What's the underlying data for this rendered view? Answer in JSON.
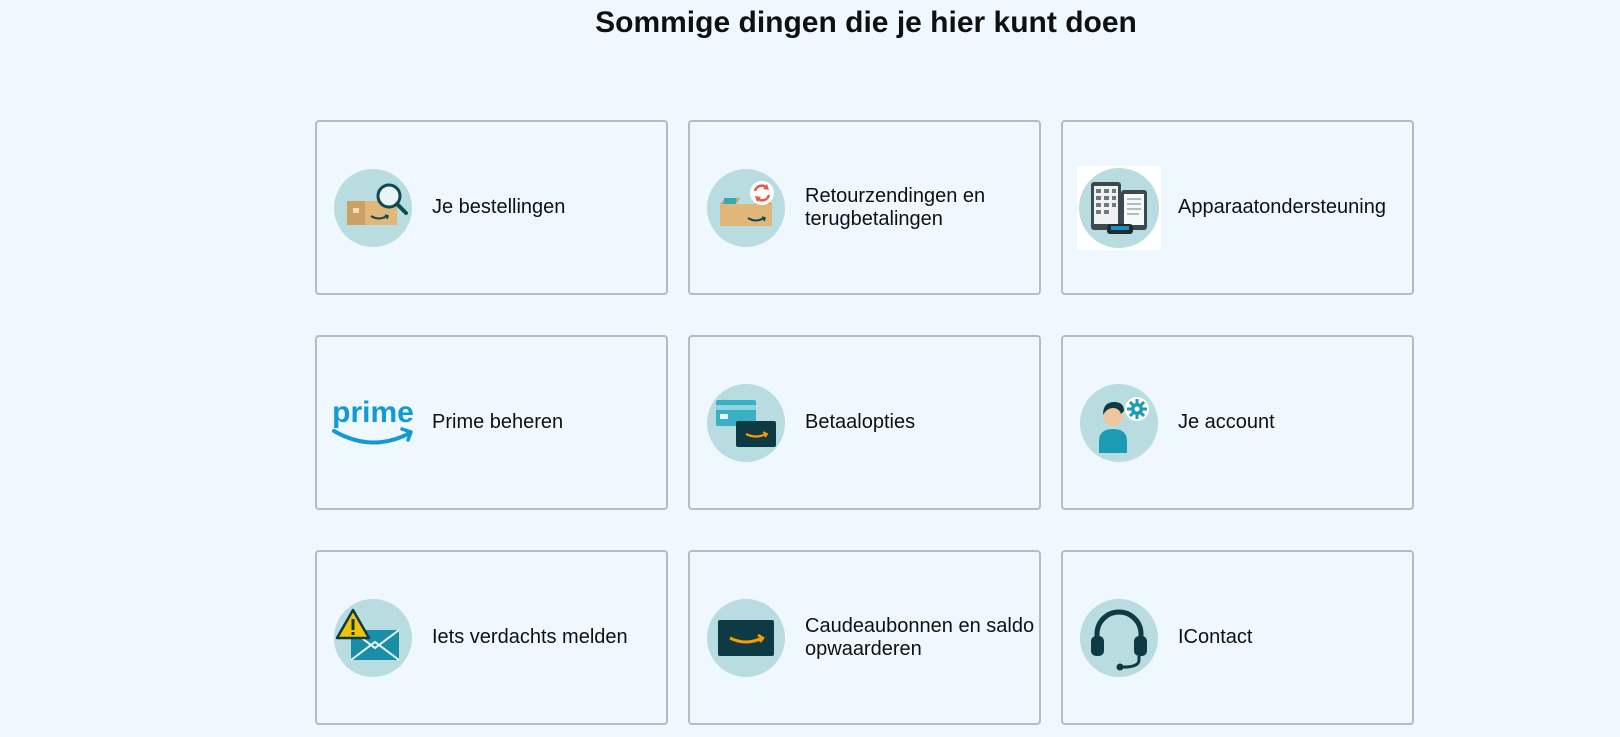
{
  "page": {
    "title": "Sommige dingen die je hier kunt doen"
  },
  "cards": [
    {
      "label": "Je bestellingen",
      "icon": "orders-box-search-icon"
    },
    {
      "label": "Retourzendingen en terugbetalingen",
      "icon": "returns-box-arrows-icon"
    },
    {
      "label": "Apparaatondersteuning",
      "icon": "devices-icon"
    },
    {
      "label": "Prime beheren",
      "icon": "prime-logo-icon",
      "icon_text": "prime"
    },
    {
      "label": "Betaalopties",
      "icon": "payment-cards-icon"
    },
    {
      "label": "Je account",
      "icon": "account-person-gear-icon"
    },
    {
      "label": "Iets verdachts melden",
      "icon": "warning-envelope-icon"
    },
    {
      "label": "Caudeaubonnen en saldo opwaarderen",
      "icon": "gift-card-icon"
    },
    {
      "label": "IContact",
      "icon": "headset-icon"
    }
  ],
  "colors": {
    "background": "#eff7ff",
    "card_border": "#b7bcc2",
    "icon_circle": "#b8dcdf",
    "dark_teal": "#0e4a55",
    "prime_blue": "#1399d3",
    "amazon_orange": "#ff9900"
  }
}
